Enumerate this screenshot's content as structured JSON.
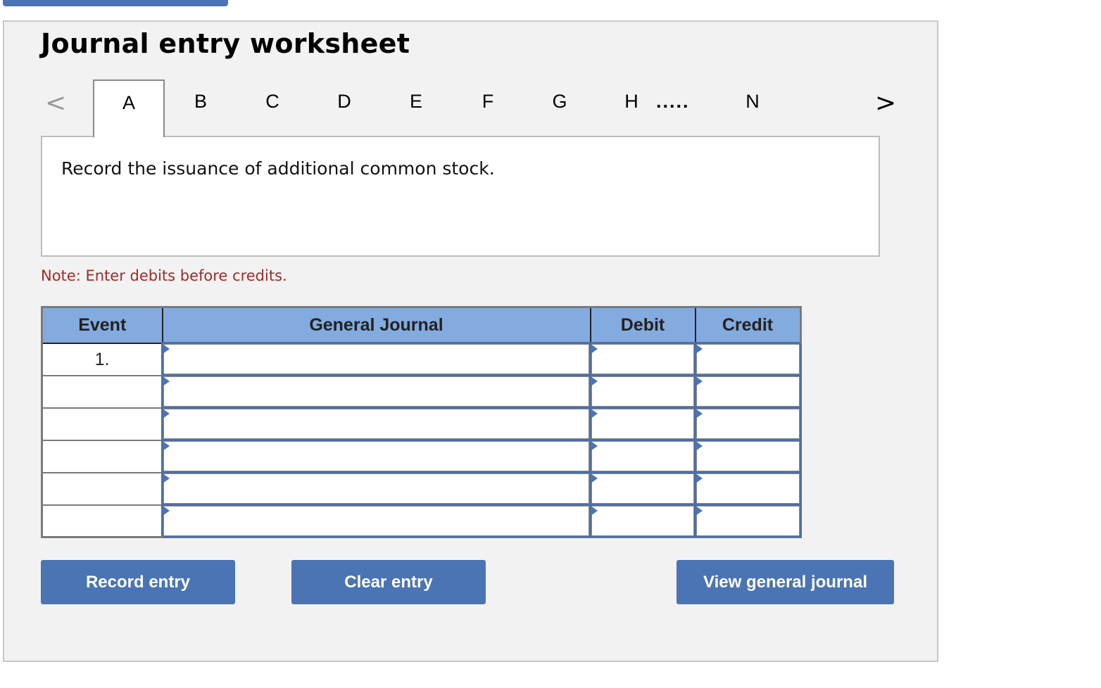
{
  "worksheet": {
    "title": "Journal entry worksheet",
    "tabs": [
      {
        "label": "A",
        "active": true
      },
      {
        "label": "B",
        "active": false
      },
      {
        "label": "C",
        "active": false
      },
      {
        "label": "D",
        "active": false
      },
      {
        "label": "E",
        "active": false
      },
      {
        "label": "F",
        "active": false
      },
      {
        "label": "G",
        "active": false
      },
      {
        "label": "H",
        "active": false
      },
      {
        "label": "N",
        "active": false
      }
    ],
    "tab_ellipsis": ".....",
    "nav": {
      "prev_icon": "chevron-left-icon",
      "prev_glyph": "<",
      "next_icon": "chevron-right-icon",
      "next_glyph": ">"
    },
    "description": "Record the issuance of additional common stock.",
    "note": "Note: Enter debits before credits.",
    "table": {
      "headers": {
        "event": "Event",
        "general_journal": "General Journal",
        "debit": "Debit",
        "credit": "Credit"
      },
      "rows": [
        {
          "event": "1.",
          "general_journal": "",
          "debit": "",
          "credit": ""
        },
        {
          "event": "",
          "general_journal": "",
          "debit": "",
          "credit": ""
        },
        {
          "event": "",
          "general_journal": "",
          "debit": "",
          "credit": ""
        },
        {
          "event": "",
          "general_journal": "",
          "debit": "",
          "credit": ""
        },
        {
          "event": "",
          "general_journal": "",
          "debit": "",
          "credit": ""
        },
        {
          "event": "",
          "general_journal": "",
          "debit": "",
          "credit": ""
        }
      ]
    },
    "buttons": {
      "record": "Record entry",
      "clear": "Clear entry",
      "view": "View general journal"
    }
  },
  "colors": {
    "accent": "#4a74b3",
    "header_bg": "#84abdf",
    "note": "#a12a2a",
    "panel_bg": "#f2f2f2"
  }
}
